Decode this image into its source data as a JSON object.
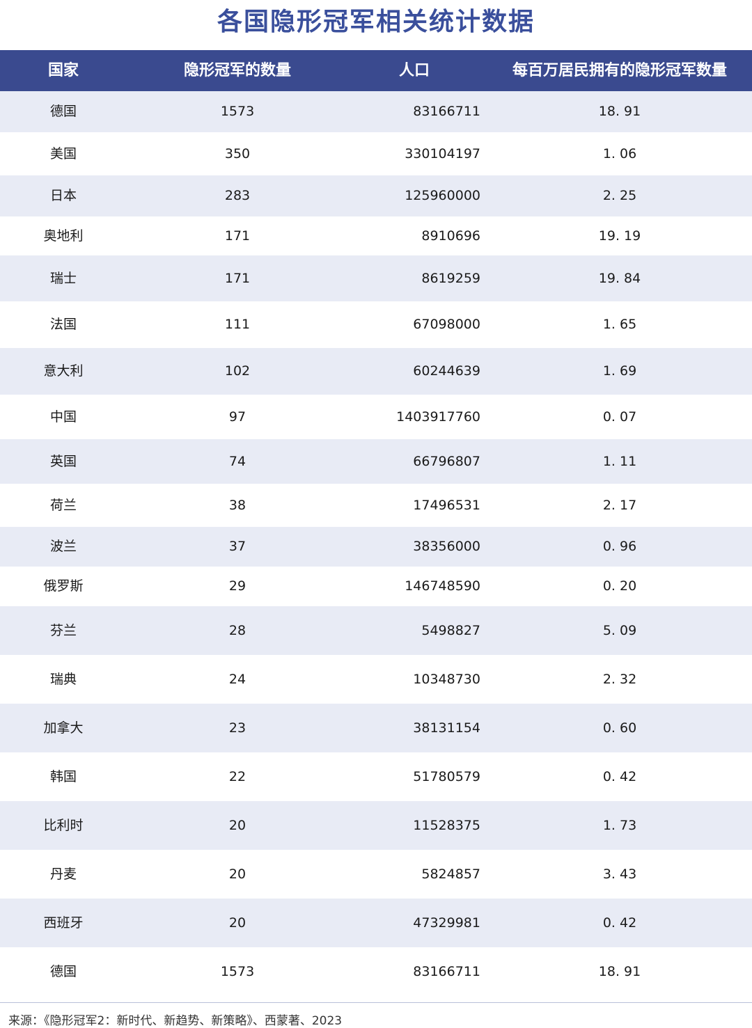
{
  "title": "各国隐形冠军相关统计数据",
  "header": {
    "country": "国家",
    "count": "隐形冠军的数量",
    "population": "人口",
    "ratio": "每百万居民拥有的隐形冠军数量"
  },
  "colors": {
    "title": "#3a4f9c",
    "header_bg": "#3a4a8f",
    "shaded_row": "#e8ebf5"
  },
  "chart_data": {
    "type": "table",
    "columns": [
      "国家",
      "隐形冠军的数量",
      "人口",
      "每百万居民拥有的隐形冠军数量"
    ],
    "rows": [
      {
        "country": "德国",
        "count": "1573",
        "population": "83166711",
        "ratio": "18. 91"
      },
      {
        "country": "美国",
        "count": "350",
        "population": "330104197",
        "ratio": "1. 06"
      },
      {
        "country": "日本",
        "count": "283",
        "population": "125960000",
        "ratio": "2. 25"
      },
      {
        "country": "奥地利",
        "count": "171",
        "population": "8910696",
        "ratio": "19. 19"
      },
      {
        "country": "瑞士",
        "count": "171",
        "population": "8619259",
        "ratio": "19. 84"
      },
      {
        "country": "法国",
        "count": "111",
        "population": "67098000",
        "ratio": "1. 65"
      },
      {
        "country": "意大利",
        "count": "102",
        "population": "60244639",
        "ratio": "1. 69"
      },
      {
        "country": "中国",
        "count": "97",
        "population": "1403917760",
        "ratio": "0. 07"
      },
      {
        "country": "英国",
        "count": "74",
        "population": "66796807",
        "ratio": "1. 11"
      },
      {
        "country": "荷兰",
        "count": "38",
        "population": "17496531",
        "ratio": "2. 17"
      },
      {
        "country": "波兰",
        "count": "37",
        "population": "38356000",
        "ratio": "0. 96"
      },
      {
        "country": "俄罗斯",
        "count": "29",
        "population": "146748590",
        "ratio": "0. 20"
      },
      {
        "country": "芬兰",
        "count": "28",
        "population": "5498827",
        "ratio": "5. 09"
      },
      {
        "country": "瑞典",
        "count": "24",
        "population": "10348730",
        "ratio": "2. 32"
      },
      {
        "country": "加拿大",
        "count": "23",
        "population": "38131154",
        "ratio": "0. 60"
      },
      {
        "country": "韩国",
        "count": "22",
        "population": "51780579",
        "ratio": "0. 42"
      },
      {
        "country": "比利时",
        "count": "20",
        "population": "11528375",
        "ratio": "1. 73"
      },
      {
        "country": "丹麦",
        "count": "20",
        "population": "5824857",
        "ratio": "3. 43"
      },
      {
        "country": "西班牙",
        "count": "20",
        "population": "47329981",
        "ratio": "0. 42"
      },
      {
        "country": "德国",
        "count": "1573",
        "population": "83166711",
        "ratio": "18. 91"
      }
    ]
  },
  "source": "来源：《隐形冠军2：新时代、新趋势、新策略》、西蒙著、2023"
}
